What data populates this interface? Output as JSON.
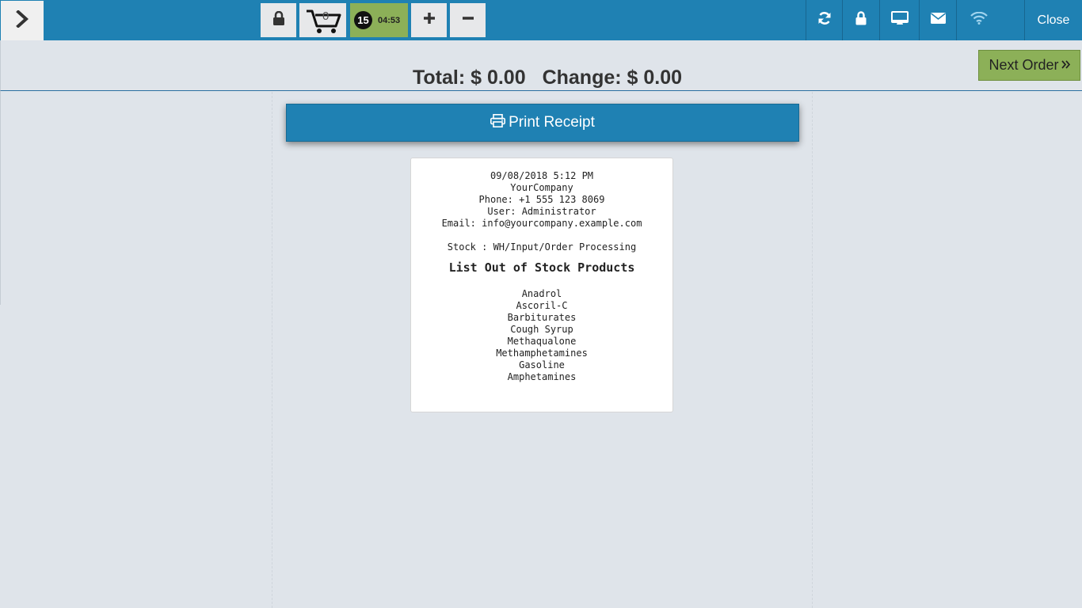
{
  "topbar": {
    "cart_count": "0",
    "timer_badge": "15",
    "timer_time": "04:53",
    "close_label": "Close",
    "icons": [
      "chevron-right-icon",
      "lock-icon",
      "cart-icon",
      "plus-icon",
      "minus-icon",
      "refresh-icon",
      "lock-icon",
      "monitor-icon",
      "envelope-icon",
      "wifi-icon"
    ]
  },
  "summary": {
    "total_label": "Total:",
    "total_value": "$ 0.00",
    "change_label": "Change:",
    "change_value": "$ 0.00",
    "next_order_label": "Next Order"
  },
  "print_button": {
    "label": "Print Receipt"
  },
  "receipt": {
    "datetime": "09/08/2018 5:12 PM",
    "company": "YourCompany",
    "phone": "Phone: +1 555 123 8069",
    "user": "User: Administrator",
    "email": "Email: info@yourcompany.example.com",
    "stock": "Stock : WH/Input/Order Processing",
    "title": "List Out of Stock Products",
    "products": [
      "Anadrol",
      "Ascoril-C",
      "Barbiturates",
      "Cough Syrup",
      "Methaqualone",
      "Methamphetamines",
      "Gasoline",
      "Amphetamines"
    ]
  },
  "colors": {
    "topbar": "#1f81b3",
    "accent_green": "#8cb058",
    "background": "#dfe4ea"
  }
}
